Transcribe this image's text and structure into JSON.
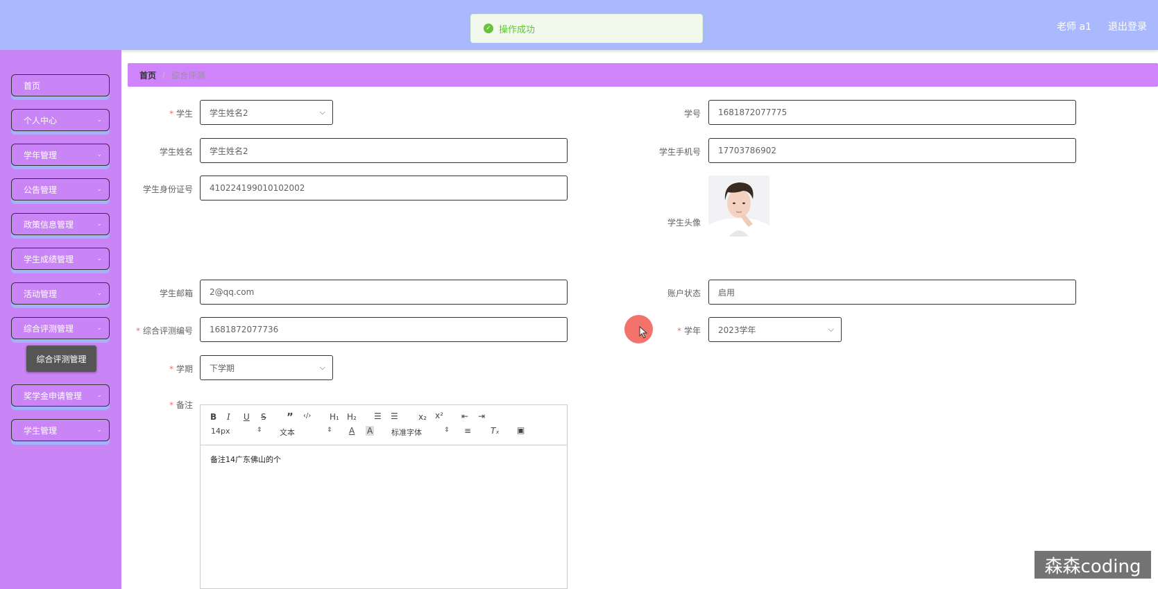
{
  "header": {
    "user": "老师 a1",
    "logout": "退出登录"
  },
  "toast": {
    "message": "操作成功"
  },
  "sidebar": {
    "items": [
      {
        "label": "首页"
      },
      {
        "label": "个人中心"
      },
      {
        "label": "学年管理"
      },
      {
        "label": "公告管理"
      },
      {
        "label": "政策信息管理"
      },
      {
        "label": "学生成绩管理"
      },
      {
        "label": "活动管理"
      },
      {
        "label": "综合评测管理"
      },
      {
        "label": "奖学金申请管理"
      },
      {
        "label": "学生管理"
      }
    ],
    "submenu": "综合评测管理"
  },
  "breadcrumb": {
    "home": "首页",
    "separator": "/",
    "current": "综合评测"
  },
  "form": {
    "student": {
      "label": "学生",
      "value": "学生姓名2"
    },
    "student_no": {
      "label": "学号",
      "value": "1681872077775"
    },
    "student_name": {
      "label": "学生姓名",
      "value": "学生姓名2"
    },
    "phone": {
      "label": "学生手机号",
      "value": "17703786902"
    },
    "id_card": {
      "label": "学生身份证号",
      "value": "410224199010102002"
    },
    "avatar": {
      "label": "学生头像"
    },
    "email": {
      "label": "学生邮箱",
      "value": "2@qq.com"
    },
    "account_status": {
      "label": "账户状态",
      "value": "启用"
    },
    "eval_no": {
      "label": "综合评测编号",
      "value": "1681872077736"
    },
    "school_year": {
      "label": "学年",
      "value": "2023学年"
    },
    "term": {
      "label": "学期",
      "value": "下学期"
    },
    "remark": {
      "label": "备注"
    }
  },
  "editor": {
    "font_size": "14px",
    "block_type": "文本",
    "font_family": "标准字体",
    "content": "备注14广东佛山的个"
  },
  "watermark": "森森coding"
}
